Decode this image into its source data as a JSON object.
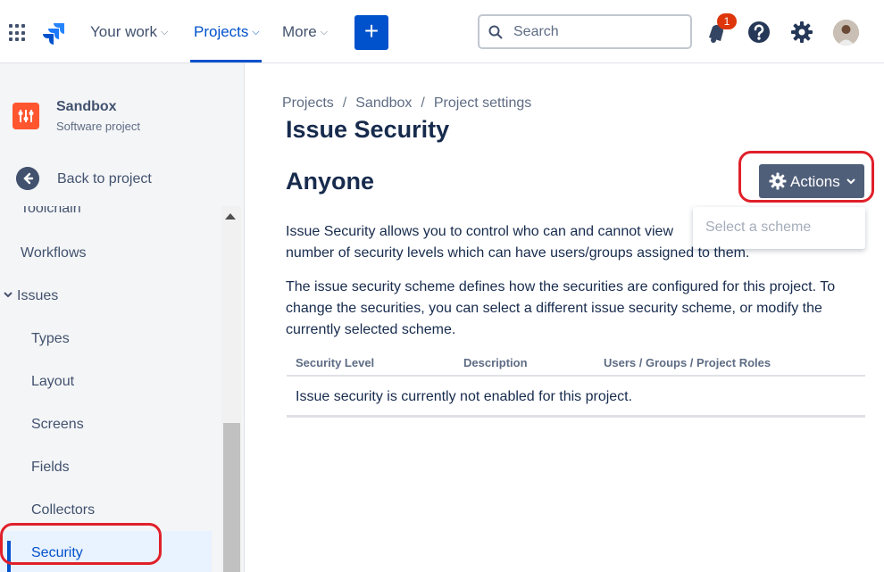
{
  "topnav": {
    "items": [
      {
        "label": "Your work"
      },
      {
        "label": "Projects"
      },
      {
        "label": "More"
      }
    ],
    "create_label": "+",
    "search_placeholder": "Search",
    "notification_count": "1"
  },
  "sidebar": {
    "project_name": "Sandbox",
    "project_type": "Software project",
    "back_label": "Back to project",
    "items": [
      {
        "label": "Toolchain"
      },
      {
        "label": "Workflows"
      },
      {
        "label": "Issues"
      },
      {
        "label": "Types"
      },
      {
        "label": "Layout"
      },
      {
        "label": "Screens"
      },
      {
        "label": "Fields"
      },
      {
        "label": "Collectors"
      },
      {
        "label": "Security"
      }
    ]
  },
  "main": {
    "breadcrumbs": [
      "Projects",
      "Sandbox",
      "Project settings"
    ],
    "title": "Issue Security",
    "scheme_name": "Anyone",
    "actions_label": "Actions",
    "dropdown_item": "Select a scheme",
    "para1_line1": "Issue Security allows you to control who can and cannot view",
    "para1_line2": "number of security levels which can have users/groups assigned to them.",
    "para2": "The issue security scheme defines how the securities are configured for this project. To change the securities, you can select a different issue security scheme, or modify the currently selected scheme.",
    "table": {
      "headers": [
        "Security Level",
        "Description",
        "Users / Groups / Project Roles"
      ],
      "empty_message": "Issue security is currently not enabled for this project."
    }
  },
  "colors": {
    "primary": "#0052CC",
    "sidebar_bg": "#F4F5F7",
    "actions_bg": "#505F79",
    "annotation": "#E0202A",
    "badge": "#DE350B"
  }
}
